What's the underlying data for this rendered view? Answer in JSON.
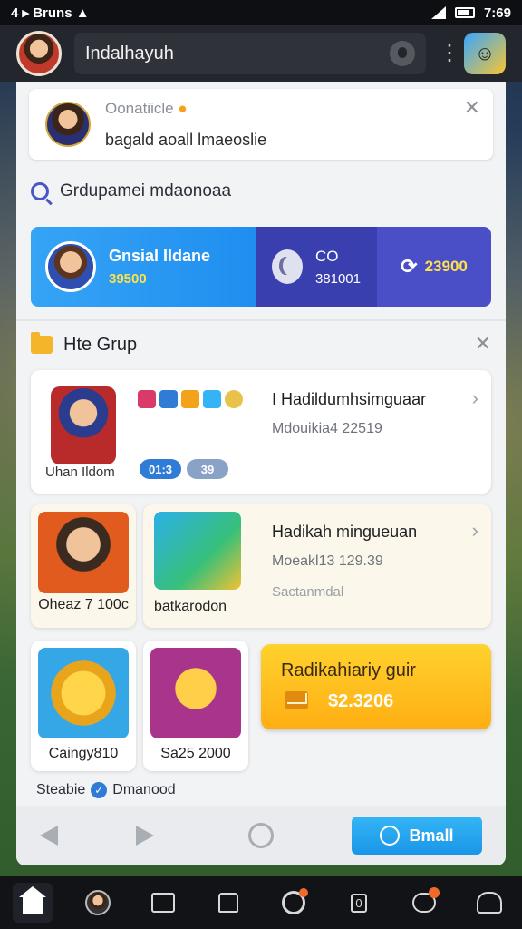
{
  "status_bar": {
    "left": "4 ▸ Bruns ▲",
    "time": "7:69"
  },
  "app_bar": {
    "title": "Indalhayuh",
    "icons": [
      "avatar",
      "mic-icon",
      "kebab-icon",
      "app-icon"
    ]
  },
  "notice": {
    "title": "Oonatiicle",
    "text": "bagald aoall lmaeoslie"
  },
  "group_search": {
    "placeholder": "Grdupamei mdaonoaa"
  },
  "banner": {
    "player_name": "Gnsial Ildane",
    "player_score": "39500",
    "mid_line1": "CO",
    "mid_line2": "381001",
    "right_value": "23900"
  },
  "section": {
    "title": "Hte Grup"
  },
  "card_main": {
    "portrait_label": "Uhan Ildom",
    "title": "I Hadildumhsimguaar",
    "subtitle": "Mdouikia4 22519",
    "pill_a": "01:3",
    "pill_b": "39"
  },
  "tile_a": {
    "label": "Oheaz 7 100c"
  },
  "wide_card": {
    "art_label": "batkarodon",
    "title": "Hadikah mingueuan",
    "subtitle": "Moeakl13 129.39",
    "subtitle2": "Sactanmdal"
  },
  "tile_c": {
    "label": "Caingy810"
  },
  "tile_d": {
    "label": "Sa25 2000"
  },
  "promo": {
    "title": "Radikahiariy guir",
    "amount": "$2.3206"
  },
  "footer_note": {
    "left": "Steabie",
    "right": "Dmanood"
  },
  "sheet_nav": {
    "primary_label": "Bmall"
  },
  "colors": {
    "accent": "#1a96e8",
    "promo": "#ffae12",
    "banner_blue": "#36a4f5",
    "banner_indigo": "#3a3fb0"
  }
}
